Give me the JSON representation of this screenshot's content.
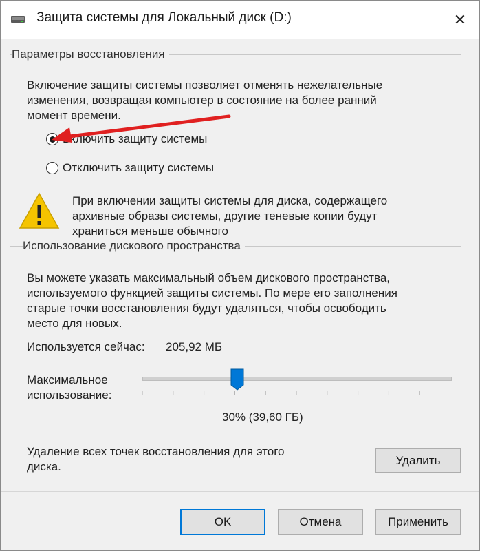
{
  "window": {
    "title": "Защита системы для Локальный диск (D:)",
    "close_glyph": "✕"
  },
  "restore": {
    "group_label": "Параметры восстановления",
    "description_lines": [
      "Включение защиты системы позволяет отменять нежелательные",
      "изменения, возвращая компьютер в состояние на более ранний",
      "момент времени."
    ],
    "options": [
      {
        "label": "Включить защиту системы",
        "selected": true
      },
      {
        "label": "Отключить защиту системы",
        "selected": false
      }
    ],
    "warning_lines": [
      "При включении защиты системы для диска, содержащего",
      "архивные образы системы, другие теневые копии будут",
      "храниться меньше обычного"
    ]
  },
  "disk": {
    "group_label": "Использование дискового пространства",
    "description_lines": [
      "Вы можете указать максимальный объем дискового пространства,",
      "используемого функцией защиты системы. По мере его заполнения",
      "старые точки восстановления будут удаляться, чтобы освободить",
      "место для новых."
    ],
    "used_label": "Используется сейчас:",
    "used_value": "205,92 МБ",
    "max_label_lines": [
      "Максимальное",
      "использование:"
    ],
    "slider_fraction": 0.3,
    "slider_value_text": "30% (39,60 ГБ)",
    "delete_text_lines": [
      "Удаление всех точек восстановления для этого",
      "диска."
    ],
    "delete_button": "Удалить"
  },
  "buttons": {
    "ok": "OK",
    "cancel": "Отмена",
    "apply": "Применить"
  },
  "colors": {
    "accent": "#0078d7",
    "arrow": "#e02020",
    "warning": "#f5c400"
  }
}
